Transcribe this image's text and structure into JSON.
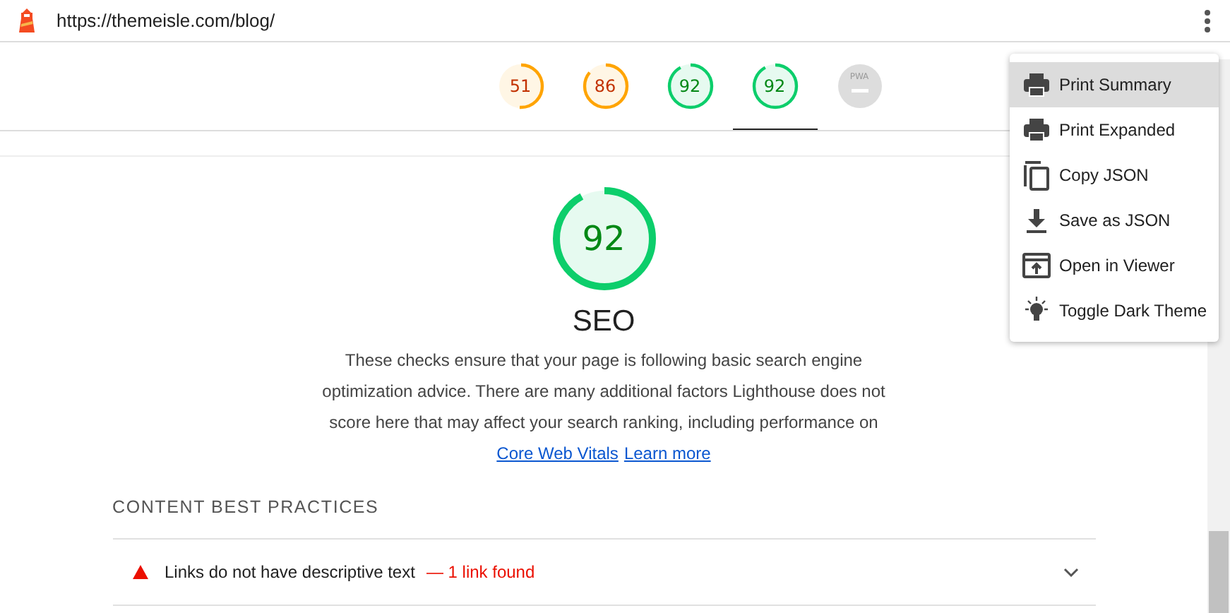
{
  "url": "https://themeisle.com/blog/",
  "gauges": [
    {
      "score": "51",
      "kind": "score",
      "color": "#ffa400",
      "selected": false
    },
    {
      "score": "86",
      "kind": "score",
      "color": "#ffa400",
      "selected": false
    },
    {
      "score": "92",
      "kind": "score",
      "color": "#0cce6b",
      "selected": false
    },
    {
      "score": "92",
      "kind": "score",
      "color": "#0cce6b",
      "selected": true
    },
    {
      "score": "PWA",
      "kind": "pwa",
      "selected": false
    }
  ],
  "category": {
    "score": "92",
    "color": "#0cce6b",
    "title": "SEO",
    "description": "These checks ensure that your page is following basic search engine optimization advice. There are many additional factors Lighthouse does not score here that may affect your search ranking, including performance on ",
    "links": [
      "Core Web Vitals",
      "Learn more"
    ]
  },
  "section": "CONTENT BEST PRACTICES",
  "audits": [
    {
      "title": "Links do not have descriptive text",
      "separator": "—",
      "detail": "1 link found",
      "color": "#eb0f00"
    }
  ],
  "menu": [
    {
      "label": "Print Summary",
      "kind": "print",
      "selected": true
    },
    {
      "label": "Print Expanded",
      "kind": "print",
      "selected": false
    },
    {
      "label": "Copy JSON",
      "kind": "copy",
      "selected": false
    },
    {
      "label": "Save as JSON",
      "kind": "save",
      "selected": false
    },
    {
      "label": "Open in Viewer",
      "kind": "open",
      "selected": false
    },
    {
      "label": "Toggle Dark Theme",
      "kind": "bulb",
      "selected": false
    }
  ]
}
